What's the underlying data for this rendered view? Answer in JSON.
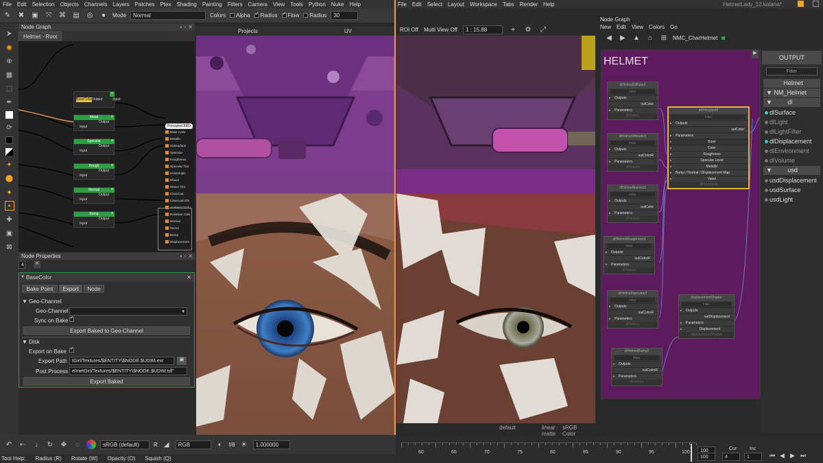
{
  "mari_menu": [
    "File",
    "Edit",
    "Selection",
    "Objects",
    "Channels",
    "Layers",
    "Patches",
    "Ptex",
    "Shading",
    "Painting",
    "Filters",
    "Camera",
    "View",
    "Tools",
    "Python",
    "Nuke",
    "Help"
  ],
  "toolbar": {
    "mode_label": "Mode",
    "mode_value": "Normal",
    "colors_label": "Colors",
    "alpha_label": "Alpha",
    "radius_label": "Radius",
    "flow_label": "Flow",
    "radius2_label": "Radius",
    "radius2_value": "30"
  },
  "node_graph": {
    "title": "Node Graph",
    "tab": "Helmet - Root",
    "nodes": [
      {
        "name": "BaseColor",
        "input": "Input",
        "output": "Output",
        "selected": true
      },
      {
        "name": "Metal",
        "input": "Input",
        "output": "Output"
      },
      {
        "name": "Specular",
        "input": "Input",
        "output": "Output"
      },
      {
        "name": "Rough",
        "input": "Input",
        "output": "Output"
      },
      {
        "name": "Normal",
        "input": "Input",
        "output": "Output"
      },
      {
        "name": "Bump",
        "input": "Input",
        "output": "Output"
      }
    ],
    "bsdf": {
      "title": "Principled BRD",
      "inputs": [
        "Base Color",
        "Metallic",
        "Subsurface",
        "Specular",
        "Roughness",
        "Specular Tint",
        "Anisotropic",
        "Sheen",
        "Sheen Tint",
        "Clearcoat",
        "Clearcoat Glo",
        "Ambient Occlu",
        "Emissive Colo",
        "Normal",
        "Vector",
        "Bump",
        "Displacement"
      ]
    }
  },
  "node_props": {
    "title": "Node Properties",
    "count": "4",
    "node": "BaseColor",
    "tabs": [
      "Bake Point",
      "Export",
      "Node"
    ],
    "geo_section": "Geo-Channel",
    "geo_label": "Geo-Channel",
    "sync_label": "Sync on Bake",
    "export_geo_btn": "Export Baked to Geo-Channel",
    "disk_section": "Disk",
    "export_on_bake": "Export on Bake",
    "export_path_label": "Export Path",
    "export_path": "tGirl/Textures/$ENTITY\\$NODE.$UDIM.exr",
    "post_label": "Post Process",
    "post_value": "elmetGirl/Textures/$ENTITY\\$NODE.$UDIM.tdl\"",
    "export_baked_btn": "Export Baked"
  },
  "viewport": {
    "projects": "Projects",
    "uv": "UV"
  },
  "katana_menu": [
    "File",
    "Edit",
    "Select",
    "Layout",
    "Workspace",
    "Tabs",
    "Render",
    "Help"
  ],
  "katana_title": "HelmetLady_12.katana*",
  "katana_view": {
    "roi": "ROI Off",
    "multi": "Multi View Off",
    "zoom": "1 : 15.88",
    "lin": "linear",
    "srgb": "sRGB",
    "default": "default",
    "matte": "matte",
    "color": "Color"
  },
  "kng": {
    "title": "Node Graph",
    "menu": [
      "New",
      "Edit",
      "View",
      "Colors",
      "Go"
    ],
    "path": "NMC_CharHelmet",
    "group": "HELMET",
    "nodes": [
      {
        "title": "dlHelmetDiffuse2",
        "filter": "Filter",
        "out": "Outputs",
        "port": "outColor",
        "params": "Parameters",
        "foot": "dlTexture"
      },
      {
        "title": "dlHelmetMetallic2",
        "filter": "Filter",
        "out": "Outputs",
        "port": "outColorR",
        "params": "Parameters",
        "foot": "dlTexture"
      },
      {
        "title": "dlHelmetNormal3",
        "filter": "Filter",
        "out": "Outputs",
        "port": "outColor",
        "params": "Parameters",
        "foot": "dlTexture"
      },
      {
        "title": "dlHelmetRoughness3",
        "filter": "Filter",
        "out": "Outputs",
        "port": "outColorR",
        "params": "Parameters",
        "foot": "dlTexture"
      },
      {
        "title": "dlHelmetSpecular2",
        "filter": "Filter",
        "out": "Outputs",
        "port": "outColorR",
        "params": "Parameters",
        "foot": "dlTexture"
      },
      {
        "title": "dlHelmetBump2",
        "filter": "Filter",
        "out": "Outputs",
        "port": "outColorR",
        "params": "Parameters",
        "foot": "dlTexture"
      }
    ],
    "principled": {
      "title": "dlPrincipled2",
      "filter": "Filter",
      "out": "Outputs",
      "port": "outColor",
      "params": "Parameters",
      "base": "Base",
      "rows": [
        "Color",
        "Roughness",
        "Specular Level",
        "Metallic"
      ],
      "bump": "Bump / Normal / Displacement Map",
      "value": "Value",
      "foot": "dlPrincipled"
    },
    "disp": {
      "title": "displacementShader",
      "filter": "Filter",
      "out": "Outputs",
      "port": "outDisplacement",
      "params": "Parameters",
      "row": "Displacement",
      "foot": "displacementShader"
    }
  },
  "output_panel": {
    "title": "OUTPUT",
    "filter": "Filter",
    "helmet": "Helmet",
    "nm": "NM_Helmet",
    "dl": "dl",
    "items": [
      "dlSurface",
      "dlLight",
      "dlLightFilter",
      "dlDisplacement",
      "dlEnvironment",
      "dlVolume"
    ],
    "usd": "usd",
    "usd_items": [
      "usdDisplacement",
      "usdSurface",
      "usdLight"
    ]
  },
  "bottom": {
    "colorspace": "sRGB (default)",
    "r": "R",
    "channel": "RGB",
    "fstop": "f/8",
    "exposure": "1.000000"
  },
  "help": {
    "title": "Tool Help:",
    "radius": "Radius (R)",
    "rotate": "Rotate (W)",
    "opacity": "Opacity (O)",
    "squish": "Squish (Q)"
  },
  "timeline": {
    "ticks": [
      "60",
      "65",
      "70",
      "75",
      "80",
      "85",
      "90",
      "95",
      "100"
    ],
    "start": "100",
    "end": "100",
    "cur_label": "Cur",
    "cur": "4",
    "inc_label": "Inc",
    "inc": "1"
  }
}
